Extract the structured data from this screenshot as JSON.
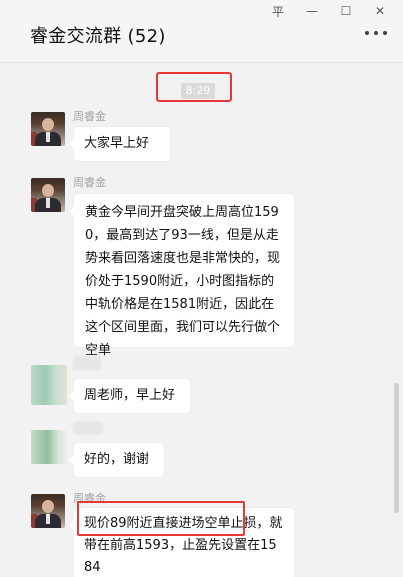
{
  "window": {
    "controls": {
      "pin": "平",
      "minimize": "—",
      "maximize": "☐",
      "close": "✕"
    }
  },
  "header": {
    "title": "睿金交流群 (52)",
    "more_icon": "more-dots-icon"
  },
  "chat": {
    "timestamp": "8:29",
    "messages": [
      {
        "sender": "周睿金",
        "text": "大家早上好",
        "avatar": "photo"
      },
      {
        "sender": "周睿金",
        "text": "黄金今早间开盘突破上周高位1590，最高到达了93一线，但是从走势来看回落速度也是非常快的，现价处于1590附近，小时图指标的中轨价格是在1581附近，因此在这个区间里面，我们可以先行做个空单",
        "avatar": "photo"
      },
      {
        "sender": "",
        "text": "周老师，早上好",
        "avatar": "blurred"
      },
      {
        "sender": "",
        "text": "好的，谢谢",
        "avatar": "blurred"
      },
      {
        "sender": "周睿金",
        "text": "现价89附近直接进场空单止损，就带在前高1593，止盈先设置在1584",
        "avatar": "photo"
      }
    ]
  },
  "colors": {
    "highlight": "#e53935",
    "background": "#f2f2f2",
    "bubble": "#ffffff"
  }
}
